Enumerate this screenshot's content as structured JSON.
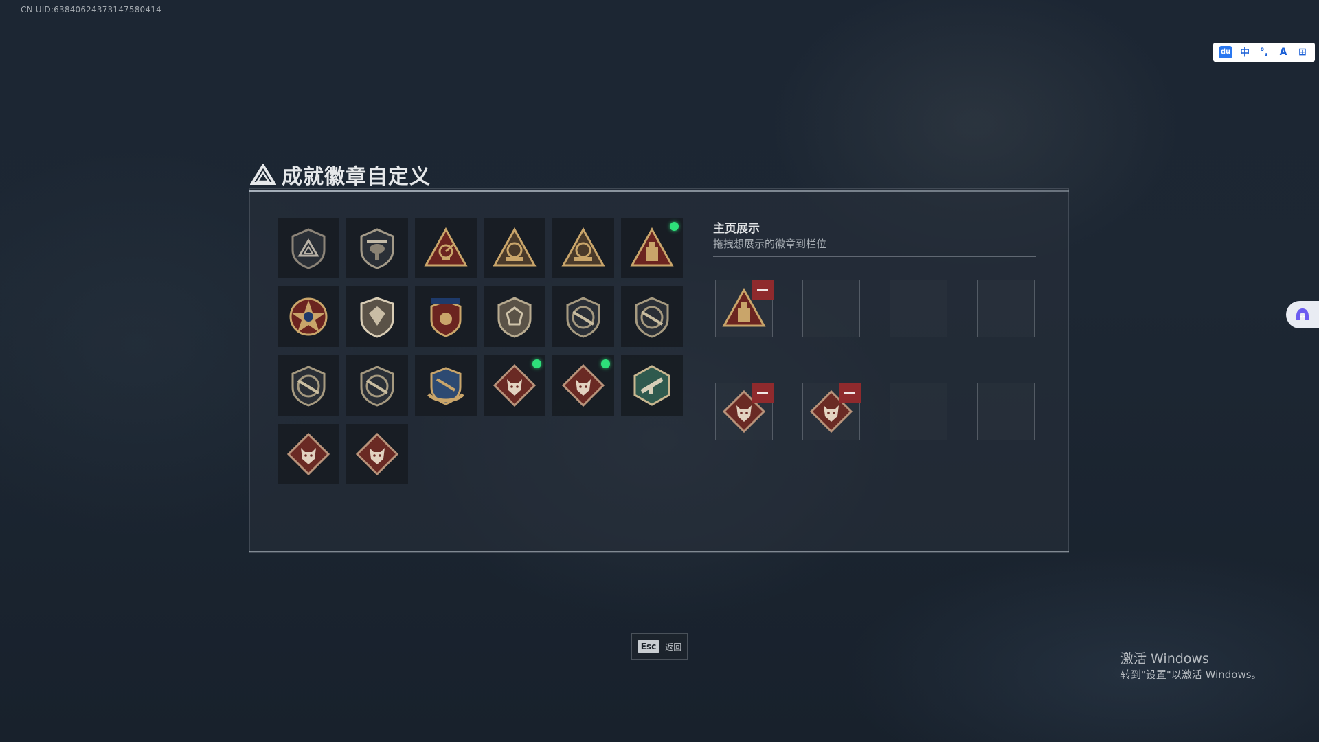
{
  "uid_text": "CN UID:63840624373147580414",
  "ime": {
    "logo": "du",
    "mode": "中",
    "punct": "°,",
    "items": [
      "du",
      "中",
      "°,",
      "A",
      "⊞"
    ]
  },
  "page_title": "成就徽章自定义",
  "badges": [
    {
      "icon": "shield-triangle-badge-icon",
      "new": false
    },
    {
      "icon": "helicopter-shield-badge-icon",
      "new": false
    },
    {
      "icon": "triangle-satellite-badge-icon",
      "new": false
    },
    {
      "icon": "triangle-s4-badge-icon",
      "new": false
    },
    {
      "icon": "triangle-s5-badge-icon",
      "new": false
    },
    {
      "icon": "triangle-vault-badge-icon",
      "new": true
    },
    {
      "icon": "star-medal-badge-icon",
      "new": false
    },
    {
      "icon": "shield-crest-badge-icon",
      "new": false
    },
    {
      "icon": "stars-shield-badge-icon",
      "new": false
    },
    {
      "icon": "gem-shield-badge-icon",
      "new": false
    },
    {
      "icon": "rifle-shield-badge-icon",
      "new": false
    },
    {
      "icon": "rifle-shield-badge-icon",
      "new": false
    },
    {
      "icon": "rifle-shield-badge-icon",
      "new": false
    },
    {
      "icon": "rifle-shield-badge-icon",
      "new": false
    },
    {
      "icon": "winged-gun-shield-badge-icon",
      "new": false
    },
    {
      "icon": "wolf-diamond-badge-icon",
      "new": true
    },
    {
      "icon": "wolf-diamond-badge-icon",
      "new": true
    },
    {
      "icon": "hex-weapon-badge-icon",
      "new": false
    },
    {
      "icon": "dragon-diamond-badge-icon",
      "new": false
    },
    {
      "icon": "runner-diamond-badge-icon",
      "new": false
    }
  ],
  "showcase": {
    "title": "主页展示",
    "subtitle": "拖拽想展示的徽章到栏位",
    "slots": [
      {
        "badge": "triangle-vault-badge-icon"
      },
      {
        "badge": null
      },
      {
        "badge": null
      },
      {
        "badge": null
      },
      {
        "badge": "wolf-diamond-badge-icon"
      },
      {
        "badge": "wolf-diamond-badge-icon"
      },
      {
        "badge": null
      },
      {
        "badge": null
      }
    ]
  },
  "footer": {
    "esc_key": "Esc",
    "esc_label": "返回"
  },
  "watermark": {
    "title": "激活 Windows",
    "subtitle": "转到\"设置\"以激活 Windows。"
  },
  "colors": {
    "new_dot": "#2ee07a",
    "remove_button": "#8f2a2d",
    "badge_gold": "#c9a56a",
    "badge_red": "#6b2420"
  }
}
